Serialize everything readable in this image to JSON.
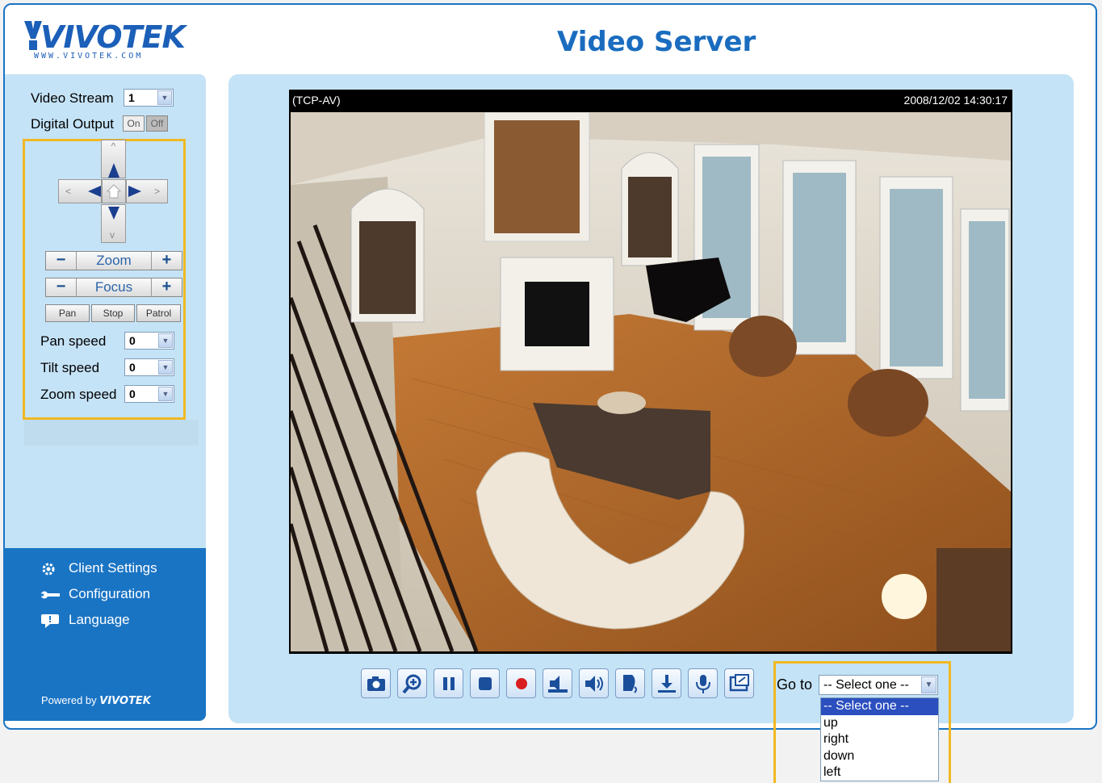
{
  "header": {
    "logo_text": "VIVOTEK",
    "logo_url_text": "WWW.VIVOTEK.COM",
    "title": "Video Server"
  },
  "sidebar": {
    "video_stream": {
      "label": "Video Stream",
      "value": "1"
    },
    "digital_output": {
      "label": "Digital Output",
      "on": "On",
      "off": "Off"
    },
    "ptz": {
      "zoom_label": "Zoom",
      "focus_label": "Focus",
      "minus": "−",
      "plus": "+",
      "pan": "Pan",
      "stop": "Stop",
      "patrol": "Patrol",
      "pan_speed": {
        "label": "Pan speed",
        "value": "0"
      },
      "tilt_speed": {
        "label": "Tilt speed",
        "value": "0"
      },
      "zoom_speed": {
        "label": "Zoom speed",
        "value": "0"
      }
    },
    "menu": [
      {
        "label": "Client Settings",
        "icon": "gear-icon"
      },
      {
        "label": "Configuration",
        "icon": "wrench-icon"
      },
      {
        "label": "Language",
        "icon": "speech-bubble-icon"
      }
    ],
    "powered_by": "Powered by",
    "powered_brand": "VIVOTEK"
  },
  "video": {
    "protocol": "(TCP-AV)",
    "timestamp": "2008/12/02 14:30:17"
  },
  "controls": [
    "camera-snapshot-icon",
    "digital-zoom-icon",
    "pause-icon",
    "stop-icon",
    "record-icon",
    "volume-mute-icon",
    "volume-icon",
    "talk-icon",
    "download-icon",
    "microphone-icon",
    "fullscreen-icon"
  ],
  "goto": {
    "label": "Go to",
    "selected": "-- Select one --",
    "options": [
      "-- Select one --",
      "up",
      "right",
      "down",
      "left"
    ]
  },
  "colors": {
    "brand_blue": "#1a74c4",
    "panel_blue": "#c5e3f6",
    "highlight": "#f0b823"
  }
}
